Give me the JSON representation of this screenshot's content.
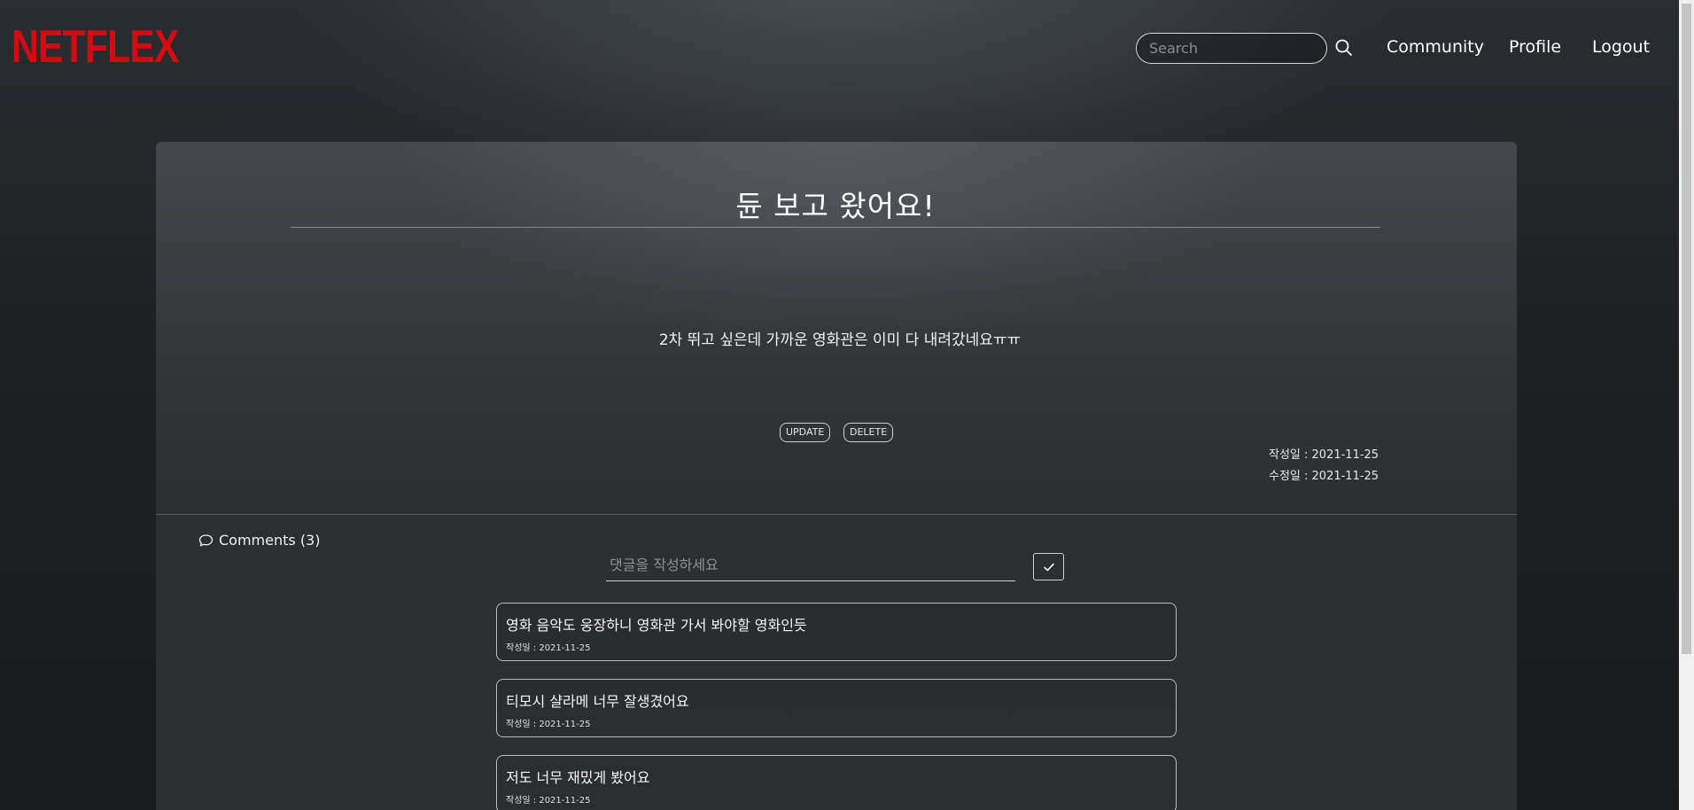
{
  "header": {
    "logo": "NETFLEX",
    "search_placeholder": "Search",
    "nav": [
      "Community",
      "Profile",
      "Logout"
    ]
  },
  "post": {
    "title": "듄 보고 왔어요!",
    "body": "2차 뛰고 싶은데 가까운 영화관은 이미 다 내려갔네요ㅠㅠ",
    "update_label": "UPDATE",
    "delete_label": "DELETE",
    "created": "작성일 : 2021-11-25",
    "modified": "수정일 : 2021-11-25"
  },
  "comments": {
    "header": "Comments (3)",
    "input_placeholder": "댓글을 작성하세요",
    "items": [
      {
        "text": "영화 음악도 웅장하니 영화관 가서 봐야할 영화인듯",
        "date": "작성일 : 2021-11-25"
      },
      {
        "text": "티모시 샬라메 너무 잘생겼어요",
        "date": "작성일 : 2021-11-25"
      },
      {
        "text": "저도 너무 재밌게 봤어요",
        "date": "작성일 : 2021-11-25"
      }
    ]
  },
  "colors": {
    "brand": "#d10c12",
    "background": "#1c1d1f",
    "card": "#34373a"
  },
  "icons": [
    "search-icon",
    "comment-bubble-icon",
    "check-icon"
  ]
}
